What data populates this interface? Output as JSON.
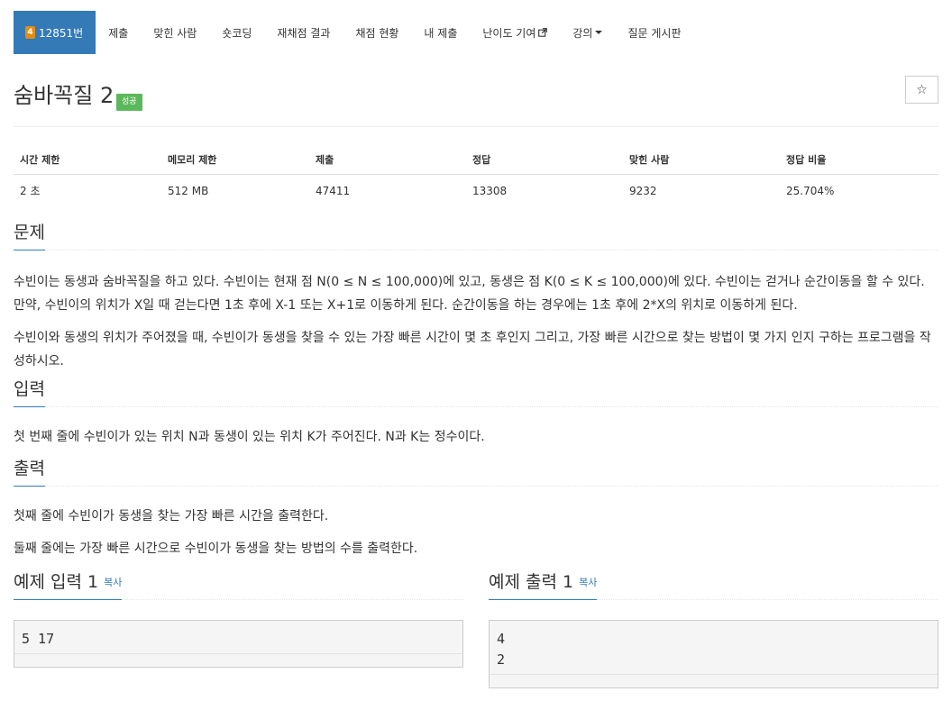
{
  "nav": {
    "tabs": [
      {
        "label": "12851번"
      },
      {
        "label": "제출"
      },
      {
        "label": "맞힌 사람"
      },
      {
        "label": "숏코딩"
      },
      {
        "label": "재채점 결과"
      },
      {
        "label": "채점 현황"
      },
      {
        "label": "내 제출"
      },
      {
        "label": "난이도 기여"
      },
      {
        "label": "강의"
      },
      {
        "label": "질문 게시판"
      }
    ],
    "badge_digit": "4",
    "accent": "#337ab7"
  },
  "problem": {
    "title": "숨바꼭질 2",
    "result_badge": "성공",
    "star_glyph": "☆"
  },
  "info": {
    "headers": [
      "시간 제한",
      "메모리 제한",
      "제출",
      "정답",
      "맞힌 사람",
      "정답 비율"
    ],
    "values": [
      "2 초",
      "512 MB",
      "47411",
      "13308",
      "9232",
      "25.704%"
    ]
  },
  "sections": {
    "description": {
      "heading": "문제",
      "p1": "수빈이는 동생과 숨바꼭질을 하고 있다. 수빈이는 현재 점 N(0 ≤ N ≤ 100,000)에 있고, 동생은 점 K(0 ≤ K ≤ 100,000)에 있다. 수빈이는 걷거나 순간이동을 할 수 있다. 만약, 수빈이의 위치가 X일 때 걷는다면 1초 후에 X-1 또는 X+1로 이동하게 된다. 순간이동을 하는 경우에는 1초 후에 2*X의 위치로 이동하게 된다.",
      "p2": "수빈이와 동생의 위치가 주어졌을 때, 수빈이가 동생을 찾을 수 있는 가장 빠른 시간이 몇 초 후인지 그리고, 가장 빠른 시간으로 찾는 방법이 몇 가지 인지 구하는 프로그램을 작성하시오."
    },
    "input": {
      "heading": "입력",
      "p1": "첫 번째 줄에 수빈이가 있는 위치 N과 동생이 있는 위치 K가 주어진다. N과 K는 정수이다."
    },
    "output": {
      "heading": "출력",
      "p1": "첫째 줄에 수빈이가 동생을 찾는 가장 빠른 시간을 출력한다.",
      "p2": "둘째 줄에는 가장 빠른 시간으로 수빈이가 동생을 찾는 방법의 수를 출력한다."
    }
  },
  "samples": {
    "input": {
      "heading": "예제 입력 1",
      "copy_label": "복사",
      "content": "5 17"
    },
    "output": {
      "heading": "예제 출력 1",
      "copy_label": "복사",
      "content": "4\n2"
    }
  }
}
